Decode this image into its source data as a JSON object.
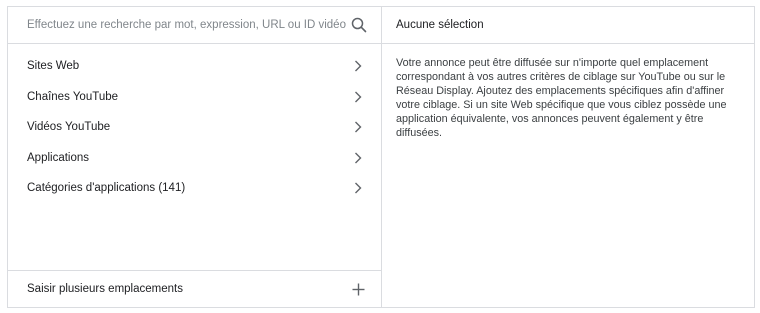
{
  "search": {
    "placeholder": "Effectuez une recherche par mot, expression, URL ou ID vidéo",
    "icon": "search-icon"
  },
  "categories": [
    {
      "label": "Sites Web",
      "icon": "chevron-right-icon"
    },
    {
      "label": "Chaînes YouTube",
      "icon": "chevron-right-icon"
    },
    {
      "label": "Vidéos YouTube",
      "icon": "chevron-right-icon"
    },
    {
      "label": "Applications",
      "icon": "chevron-right-icon"
    },
    {
      "label": "Catégories d'applications (141)",
      "icon": "chevron-right-icon"
    }
  ],
  "bottom": {
    "label": "Saisir plusieurs emplacements",
    "icon": "plus-icon"
  },
  "selection": {
    "title": "Aucune sélection",
    "description": "Votre annonce peut être diffusée sur n'importe quel emplacement correspondant à vos autres critères de ciblage sur YouTube ou sur le Réseau Display. Ajoutez des emplacements spécifiques afin d'affiner votre ciblage. Si un site Web spécifique que vous ciblez possède une application équivalente, vos annonces peuvent également y être diffusées."
  },
  "colors": {
    "border": "#dadce0",
    "text": "#202124",
    "icon": "#5f6368"
  }
}
